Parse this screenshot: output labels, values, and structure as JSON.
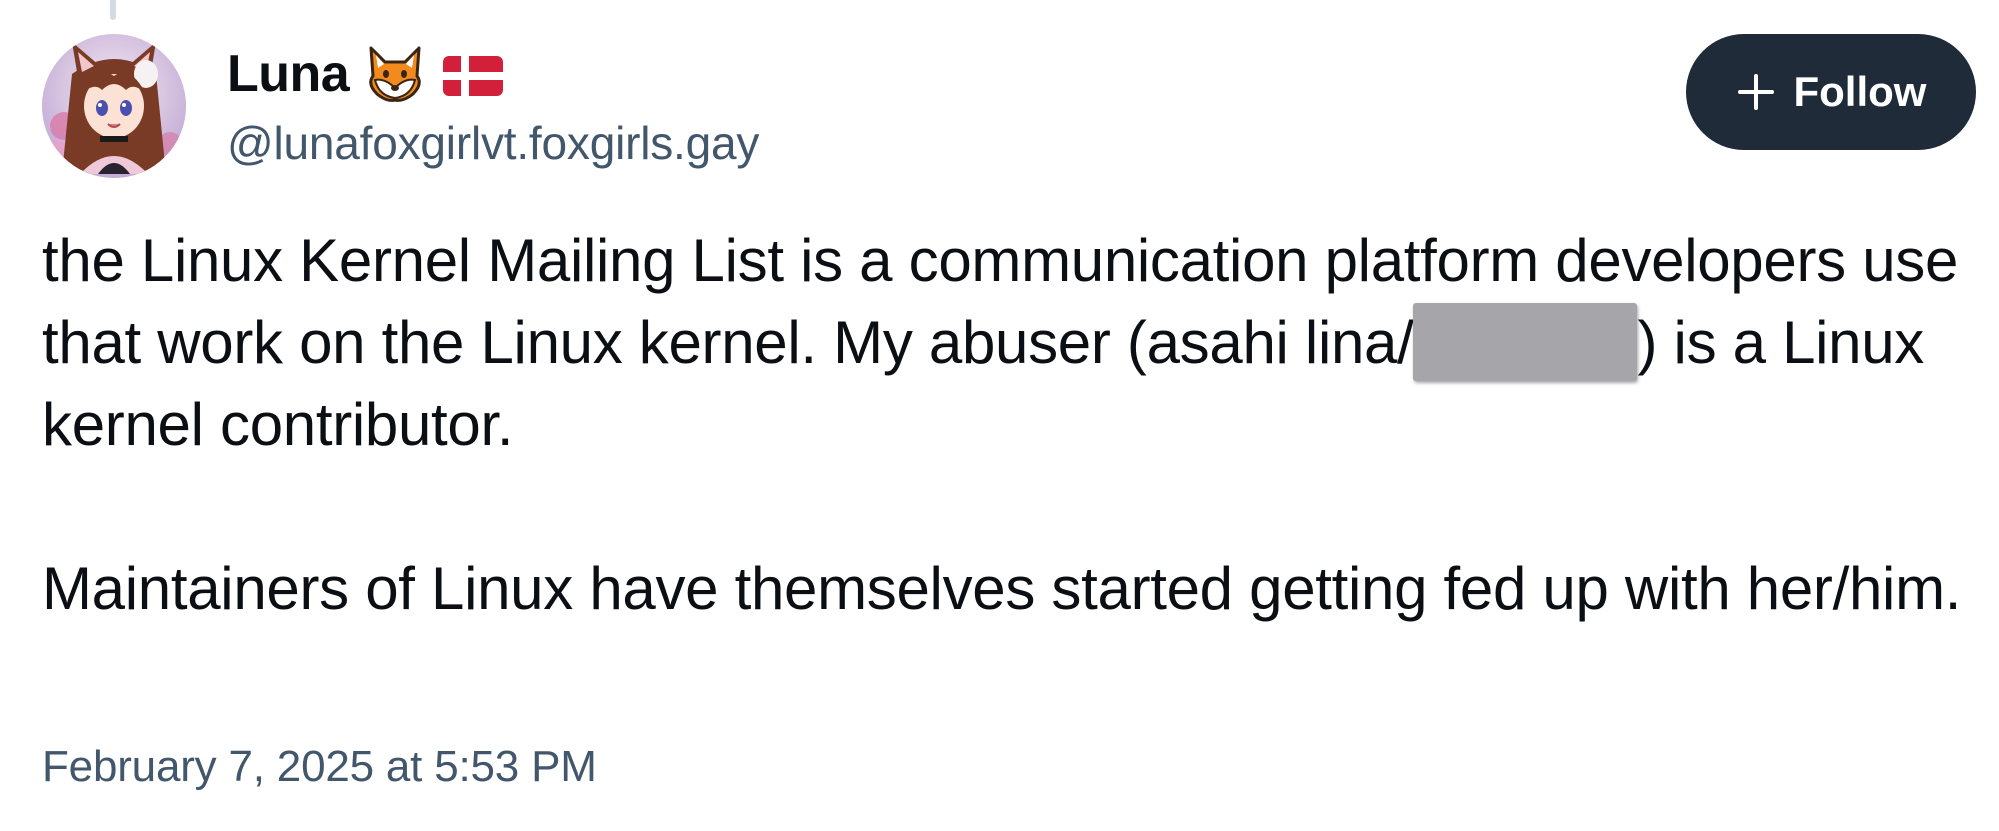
{
  "post": {
    "author": {
      "display_name": "Luna",
      "handle": "@lunafoxgirlvt.foxgirls.gay",
      "name_emojis": [
        "fox-face-icon",
        "denmark-flag-icon"
      ]
    },
    "follow_button": {
      "label": "Follow",
      "icon": "plus-icon"
    },
    "text": {
      "paragraph1_before_redaction": "the Linux Kernel Mailing List is a communication platform developers use that work on the Linux kernel. My abuser (asahi lina/",
      "paragraph1_after_redaction": ") is a Linux kernel contributor.",
      "paragraph2": "Maintainers of Linux have themselves started getting fed up with her/him."
    },
    "timestamp": "February 7, 2025 at 5:53 PM"
  },
  "colors": {
    "follow_button_bg": "#1f2b38",
    "muted_text": "#42576c",
    "redaction_box": "#a6a6aa"
  }
}
